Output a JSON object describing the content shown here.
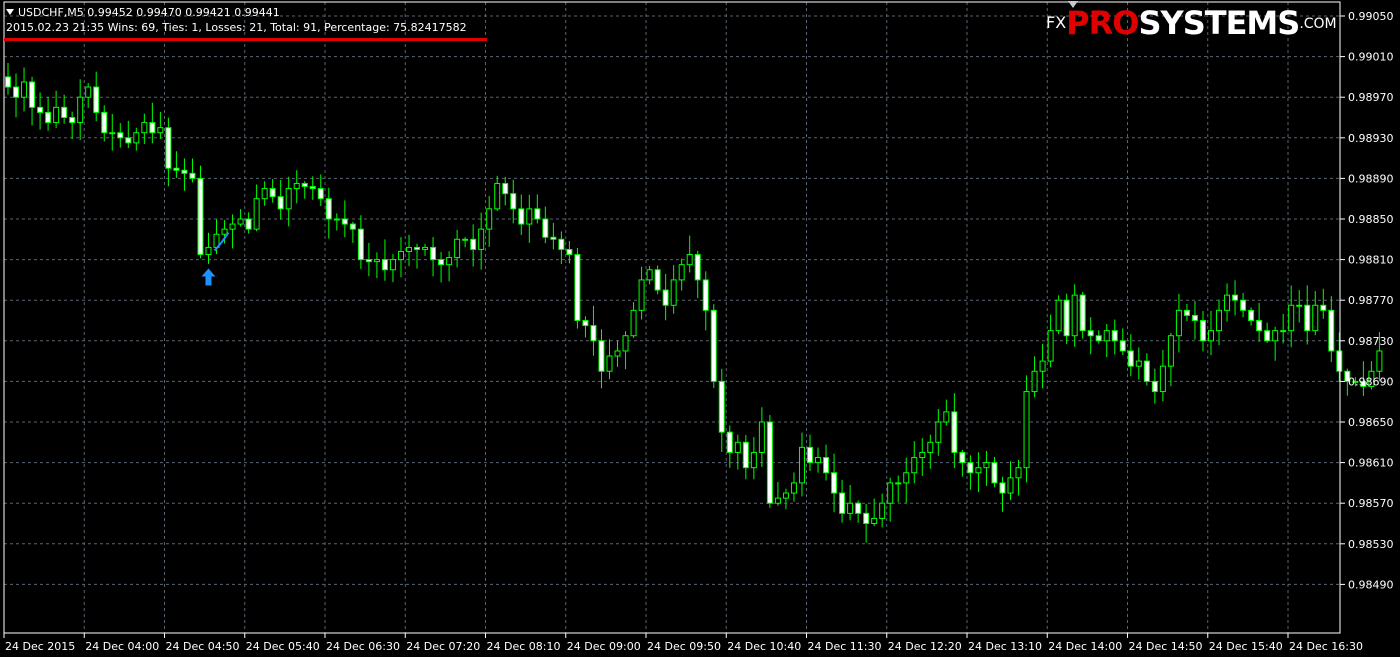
{
  "header": {
    "symbol_line": "USDCHF,M5  0.99452 0.99470 0.99421 0.99441",
    "stats_line": "2015.02.23 21:35 Wins: 69, Ties: 1, Losses: 21, Total: 91, Percentage: 75.82417582"
  },
  "logo": {
    "fx": "FX",
    "pro": "PRO",
    "systems": "SYSTEMS",
    "com": ".COM"
  },
  "colors": {
    "background": "#000000",
    "candle": "#00ff00",
    "grid": "#5a6470",
    "axis": "#ffffff",
    "signal_arrow": "#1e90ff",
    "underline": "#e00000"
  },
  "chart_data": {
    "type": "candlestick",
    "symbol": "USDCHF",
    "timeframe": "M5",
    "ylim": [
      0.9847,
      0.9907
    ],
    "yticks": [
      "0.99050",
      "0.99010",
      "0.98970",
      "0.98930",
      "0.98890",
      "0.98850",
      "0.98810",
      "0.98770",
      "0.98730",
      "0.98690",
      "0.98650",
      "0.98610",
      "0.98570",
      "0.98530",
      "0.98490"
    ],
    "xticks": [
      "24 Dec 2015",
      "24 Dec 04:00",
      "24 Dec 04:50",
      "24 Dec 05:40",
      "24 Dec 06:30",
      "24 Dec 07:20",
      "24 Dec 08:10",
      "24 Dec 09:00",
      "24 Dec 09:50",
      "24 Dec 10:40",
      "24 Dec 11:30",
      "24 Dec 12:20",
      "24 Dec 13:10",
      "24 Dec 14:00",
      "24 Dec 14:50",
      "24 Dec 15:40",
      "24 Dec 16:30"
    ],
    "grid": true,
    "close_path": [
      0.9898,
      0.9897,
      0.98985,
      0.9896,
      0.98955,
      0.98945,
      0.9896,
      0.9895,
      0.98945,
      0.9897,
      0.9898,
      0.98955,
      0.98935,
      0.98935,
      0.9893,
      0.98925,
      0.98935,
      0.98945,
      0.98935,
      0.9894,
      0.989,
      0.98898,
      0.98895,
      0.9889,
      0.98815,
      0.98822,
      0.98835,
      0.9884,
      0.98845,
      0.9885,
      0.9884,
      0.9887,
      0.9888,
      0.98872,
      0.9886,
      0.9888,
      0.98885,
      0.98882,
      0.9888,
      0.9887,
      0.9885,
      0.9885,
      0.98845,
      0.9884,
      0.9881,
      0.98808,
      0.9881,
      0.988,
      0.9881,
      0.98818,
      0.98822,
      0.9882,
      0.98822,
      0.9881,
      0.98805,
      0.98812,
      0.9883,
      0.9883,
      0.9882,
      0.9884,
      0.9886,
      0.98885,
      0.98875,
      0.9886,
      0.98845,
      0.9886,
      0.9885,
      0.98832,
      0.9883,
      0.9882,
      0.98815,
      0.9875,
      0.98745,
      0.9873,
      0.987,
      0.98715,
      0.9872,
      0.98735,
      0.9876,
      0.9879,
      0.988,
      0.9878,
      0.98765,
      0.9879,
      0.98805,
      0.98815,
      0.9879,
      0.9876,
      0.9869,
      0.9864,
      0.9862,
      0.9863,
      0.98605,
      0.9862,
      0.9865,
      0.9857,
      0.98575,
      0.9858,
      0.9859,
      0.98625,
      0.9861,
      0.98615,
      0.986,
      0.9858,
      0.9856,
      0.9857,
      0.9856,
      0.9855,
      0.98555,
      0.9857,
      0.9859,
      0.9859,
      0.986,
      0.98615,
      0.9862,
      0.9863,
      0.9865,
      0.9866,
      0.9862,
      0.9861,
      0.986,
      0.98605,
      0.9861,
      0.9859,
      0.9858,
      0.98595,
      0.98605,
      0.9868,
      0.987,
      0.9871,
      0.9874,
      0.9877,
      0.98735,
      0.98775,
      0.9874,
      0.98735,
      0.9873,
      0.9874,
      0.9873,
      0.9872,
      0.98705,
      0.9871,
      0.9869,
      0.9868,
      0.98705,
      0.98735,
      0.9876,
      0.98755,
      0.9875,
      0.9873,
      0.9874,
      0.9876,
      0.98775,
      0.9877,
      0.9876,
      0.9875,
      0.9874,
      0.9873,
      0.9874,
      0.9874,
      0.98765,
      0.98765,
      0.9874,
      0.98765,
      0.9876,
      0.9872,
      0.987,
      0.9869,
      0.9869,
      0.98685,
      0.987,
      0.9872
    ],
    "signals": [
      {
        "type": "buy",
        "at_index": 24
      }
    ]
  }
}
